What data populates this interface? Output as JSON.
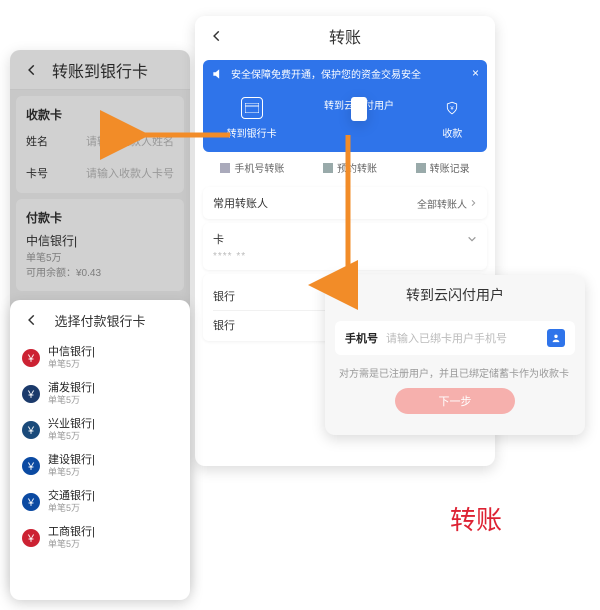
{
  "screenA": {
    "title": "转账到银行卡",
    "recv_block": "收款卡",
    "name_label": "姓名",
    "name_placeholder": "请输入收款人姓名",
    "card_label": "卡号",
    "card_placeholder": "请输入收款人卡号",
    "pay_block": "付款卡",
    "pay_bank": "中信银行|",
    "pay_limit": "单笔5万",
    "pay_balance": "可用余额：¥0.43"
  },
  "screenB": {
    "title": "转账",
    "banner": "安全保障免费开通，保护您的资金交易安全",
    "actions": {
      "to_bank": "转到银行卡",
      "to_user": "转到云闪付用户",
      "collect": "收款"
    },
    "subtabs": {
      "phone": "手机号转账",
      "schedule": "预约转账",
      "records": "转账记录"
    },
    "contacts_title": "常用转账人",
    "contacts_all": "全部转账人",
    "card_label": "卡",
    "card_mask": "**** **",
    "banks_title": "银行",
    "banks": [
      "银行",
      "银行"
    ]
  },
  "bankSheet": {
    "title": "选择付款银行卡",
    "banks": [
      {
        "name": "中信银行|",
        "sub": "单笔5万",
        "color": "#c23"
      },
      {
        "name": "浦发银行|",
        "sub": "单笔5万",
        "color": "#1b3a6b"
      },
      {
        "name": "兴业银行|",
        "sub": "单笔5万",
        "color": "#1a4a7a"
      },
      {
        "name": "建设银行|",
        "sub": "单笔5万",
        "color": "#0b4aa2"
      },
      {
        "name": "交通银行|",
        "sub": "单笔5万",
        "color": "#0b4aa2"
      },
      {
        "name": "工商银行|",
        "sub": "单笔5万",
        "color": "#c23"
      }
    ]
  },
  "screenC": {
    "title": "转到云闪付用户",
    "phone_label": "手机号",
    "phone_placeholder": "请输入已绑卡用户手机号",
    "note": "对方需是已注册用户，并且已绑定储蓄卡作为收款卡",
    "next": "下一步"
  },
  "label": "转账"
}
